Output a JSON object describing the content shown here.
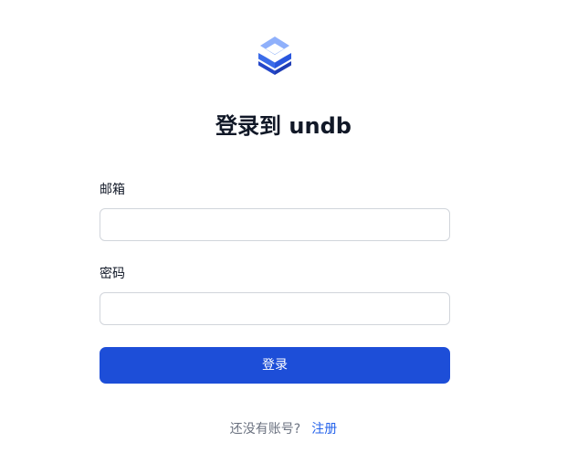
{
  "brand": {
    "logo_icon": "undb-logo-icon",
    "logo_colors": [
      "#93b4fd",
      "#5b8df6",
      "#2d5be3",
      "#1e3fb8"
    ]
  },
  "login": {
    "title": "登录到 undb",
    "email_label": "邮箱",
    "email_value": "",
    "password_label": "密码",
    "password_value": "",
    "submit_label": "登录"
  },
  "footer": {
    "prompt": "还没有账号?",
    "register_link": "注册"
  },
  "colors": {
    "primary": "#1d4ed8",
    "link": "#2563eb",
    "muted": "#6b7280",
    "border": "#d1d5db"
  }
}
